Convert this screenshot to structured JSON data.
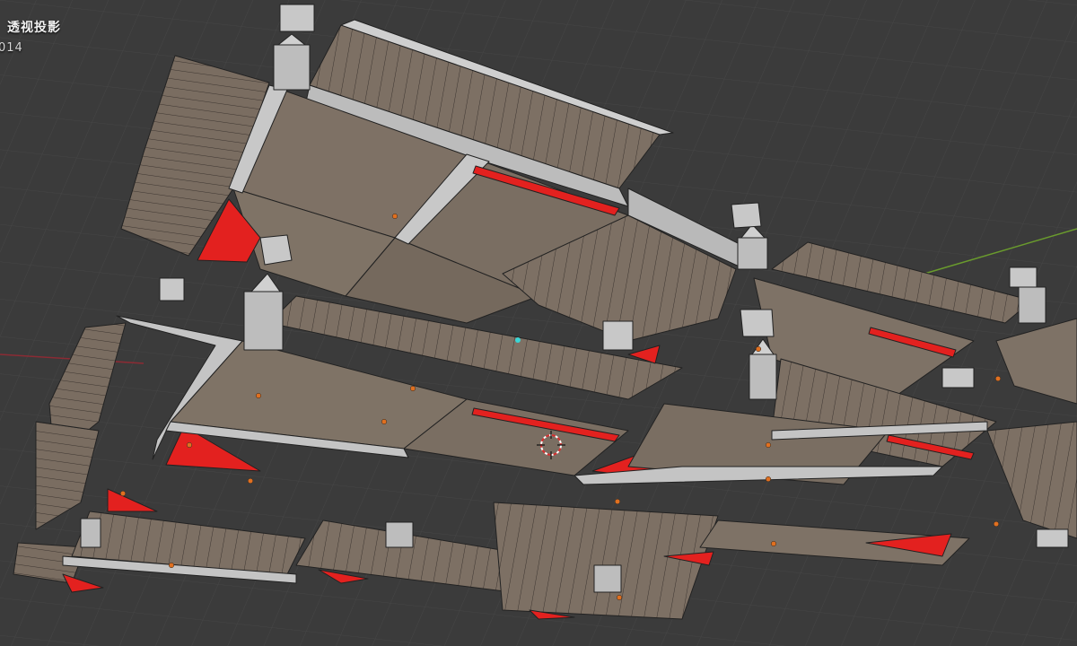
{
  "viewport": {
    "view_label": "透视投影",
    "collection_label": "014"
  },
  "colors": {
    "background": "#3b3b3b",
    "grid_line": "#454545",
    "axis_x": "#8b2b34",
    "axis_y": "#6a9b2d",
    "face_dark": "#7a6d60",
    "face_light": "#bfbfbf",
    "edge": "#222222",
    "accent_red": "#e3211f",
    "origin_dot": "#e07020",
    "cursor_red": "#d63030"
  },
  "icons": {
    "cursor": "3d-cursor-icon",
    "origin": "object-origin-icon"
  }
}
